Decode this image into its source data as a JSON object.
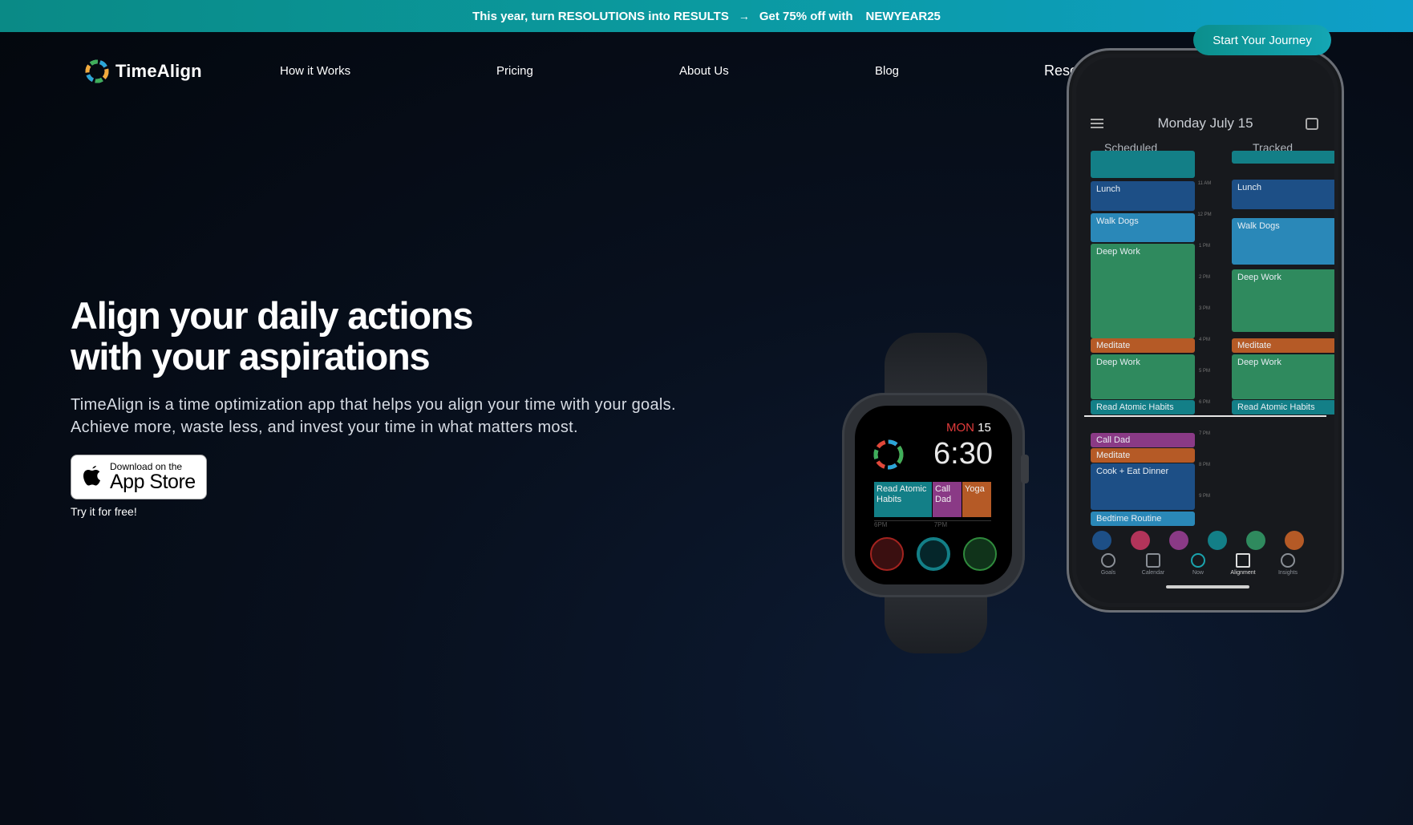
{
  "promo": {
    "text": "This year, turn RESOLUTIONS into RESULTS",
    "arrow": "→",
    "offer": "Get 75% off with",
    "code": "NEWYEAR25"
  },
  "nav": {
    "brand": "TimeAlign",
    "links": [
      "How it Works",
      "Pricing",
      "About Us",
      "Blog"
    ],
    "resources": "Resources",
    "cta": "Start Your Journey"
  },
  "hero": {
    "title_line1": "Align your daily actions",
    "title_line2": "with your aspirations",
    "sub_line1": "TimeAlign is a time optimization app that helps you align your time with your goals.",
    "sub_line2": "Achieve more, waste less, and invest your time in what matters most.",
    "appstore_small": "Download on the",
    "appstore_big": "App Store",
    "try": "Try it for free!"
  },
  "watch": {
    "day": "MON",
    "date": "15",
    "time": "6:30",
    "blocks": [
      "Read Atomic Habits",
      "Call Dad",
      "Yoga"
    ],
    "ticks": [
      "6PM",
      "7PM"
    ]
  },
  "phone": {
    "date": "Monday July 15",
    "col_scheduled": "Scheduled",
    "col_tracked": "Tracked",
    "hours": [
      "11 AM",
      "12 PM",
      "1 PM",
      "2 PM",
      "3 PM",
      "4 PM",
      "5 PM",
      "6 PM",
      "7 PM",
      "8 PM",
      "9 PM"
    ],
    "scheduled": [
      "Lunch",
      "Walk Dogs",
      "Deep Work",
      "Meditate",
      "Deep Work",
      "Read Atomic Habits",
      "Call Dad",
      "Meditate",
      "Cook + Eat Dinner",
      "Bedtime Routine"
    ],
    "tracked": [
      "Lunch",
      "Walk Dogs",
      "Deep Work",
      "Meditate",
      "Deep Work",
      "Read Atomic Habits"
    ],
    "tabs": [
      "Goals",
      "Calendar",
      "Now",
      "Alignment",
      "Insights"
    ]
  },
  "colors": {
    "accent": "#0b9aa0",
    "blue": "#1d4f86",
    "lightblue": "#2a88b8",
    "green": "#2f8a5e",
    "orange": "#b55a26",
    "purple": "#8a3a86",
    "teal": "#137f87"
  }
}
